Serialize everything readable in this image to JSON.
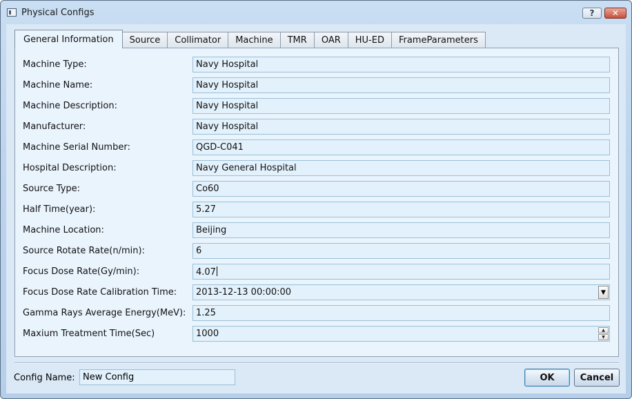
{
  "window": {
    "title": "Physical Configs",
    "help_label": "?",
    "close_label": "✕"
  },
  "tabs": [
    {
      "label": "General Information"
    },
    {
      "label": "Source"
    },
    {
      "label": "Collimator"
    },
    {
      "label": "Machine"
    },
    {
      "label": "TMR"
    },
    {
      "label": "OAR"
    },
    {
      "label": "HU-ED"
    },
    {
      "label": "FrameParameters"
    }
  ],
  "fields": [
    {
      "label": "Machine Type:",
      "value": "Navy Hospital"
    },
    {
      "label": "Machine Name:",
      "value": "Navy Hospital"
    },
    {
      "label": "Machine Description:",
      "value": "Navy Hospital"
    },
    {
      "label": "Manufacturer:",
      "value": "Navy Hospital"
    },
    {
      "label": "Machine Serial Number:",
      "value": "QGD-C041"
    },
    {
      "label": "Hospital Description:",
      "value": "Navy General Hospital"
    },
    {
      "label": "Source Type:",
      "value": "Co60"
    },
    {
      "label": "Half Time(year):",
      "value": "5.27"
    },
    {
      "label": "Machine Location:",
      "value": "Beijing"
    },
    {
      "label": "Source Rotate Rate(n/min):",
      "value": "6"
    },
    {
      "label": "Focus Dose Rate(Gy/min):",
      "value": "4.07"
    },
    {
      "label": "Focus Dose Rate Calibration Time:",
      "value": "2013-12-13 00:00:00"
    },
    {
      "label": "Gamma Rays Average Energy(MeV):",
      "value": "1.25"
    },
    {
      "label": "Maxium Treatment Time(Sec)",
      "value": "1000"
    }
  ],
  "footer": {
    "config_name_label": "Config Name:",
    "config_name_value": "New Config",
    "ok_label": "OK",
    "cancel_label": "Cancel"
  }
}
